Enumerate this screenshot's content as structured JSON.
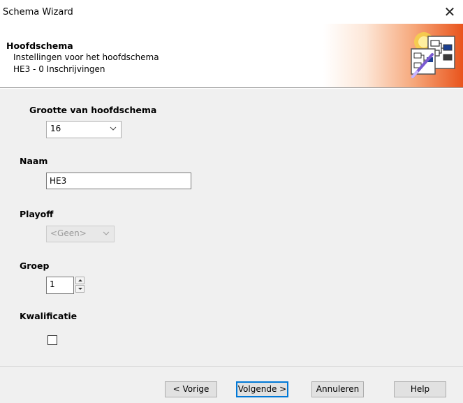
{
  "window": {
    "title": "Schema Wizard",
    "close_glyph": "✕"
  },
  "header": {
    "title": "Hoofdschema",
    "subtitle": "Instellingen voor het hoofdschema",
    "detail": "HE3 - 0 Inschrijvingen",
    "icon": "draw-schema-icon",
    "gradient_colors": [
      "#ffffff",
      "#f6a77a",
      "#e9541c"
    ]
  },
  "form": {
    "size_label": "Grootte van hoofdschema",
    "size_value": "16",
    "name_label": "Naam",
    "name_value": "HE3",
    "playoff_label": "Playoff",
    "playoff_value": "<Geen>",
    "group_label": "Groep",
    "group_value": "1",
    "qualification_label": "Kwalificatie",
    "qualification_checked": false
  },
  "buttons": {
    "back": "< Vorige",
    "next": "Volgende >",
    "cancel": "Annuleren",
    "help": "Help"
  },
  "colors": {
    "focus_border": "#0078d7",
    "panel_bg": "#f0f0f0"
  }
}
